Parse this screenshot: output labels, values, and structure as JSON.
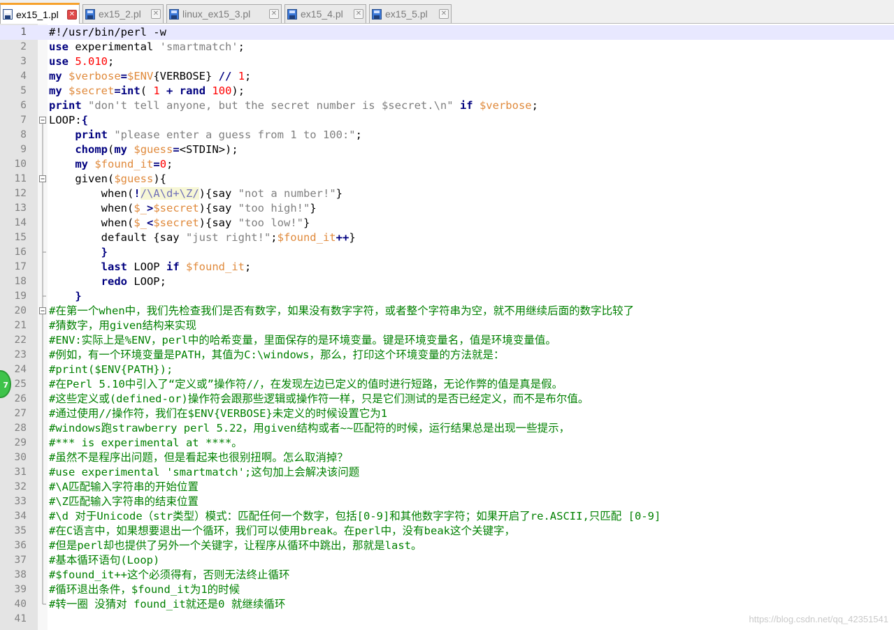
{
  "tabs": [
    {
      "label": "ex15_1.pl",
      "active": true
    },
    {
      "label": "ex15_2.pl",
      "active": false
    },
    {
      "label": "linux_ex15_3.pl",
      "active": false
    },
    {
      "label": "ex15_4.pl",
      "active": false
    },
    {
      "label": "ex15_5.pl",
      "active": false
    }
  ],
  "editor": {
    "current_line": 1,
    "lines": [
      [
        [
          "#!/usr/bin/perl -w",
          ""
        ]
      ],
      [
        [
          "use",
          "kw"
        ],
        [
          " experimental ",
          ""
        ],
        [
          "'smartmatch'",
          "str"
        ],
        [
          ";",
          ""
        ]
      ],
      [
        [
          "use",
          "kw"
        ],
        [
          " ",
          ""
        ],
        [
          "5.010",
          "num"
        ],
        [
          ";",
          ""
        ]
      ],
      [
        [
          "my",
          "kw"
        ],
        [
          " ",
          ""
        ],
        [
          "$verbose",
          "var"
        ],
        [
          "=",
          "op"
        ],
        [
          "$ENV",
          "var"
        ],
        [
          "{VERBOSE} ",
          ""
        ],
        [
          "//",
          "op"
        ],
        [
          " ",
          ""
        ],
        [
          "1",
          "num"
        ],
        [
          ";",
          ""
        ]
      ],
      [
        [
          "my",
          "kw"
        ],
        [
          " ",
          ""
        ],
        [
          "$secret",
          "var"
        ],
        [
          "=",
          "op"
        ],
        [
          "int",
          "kw"
        ],
        [
          "( ",
          ""
        ],
        [
          "1",
          "num"
        ],
        [
          " ",
          ""
        ],
        [
          "+",
          "op"
        ],
        [
          " ",
          ""
        ],
        [
          "rand",
          "kw"
        ],
        [
          " ",
          ""
        ],
        [
          "100",
          "num"
        ],
        [
          ");",
          ""
        ]
      ],
      [
        [
          "print",
          "kw"
        ],
        [
          " ",
          ""
        ],
        [
          "\"don't tell anyone, but the secret number is $secret.\\n\"",
          "str"
        ],
        [
          " ",
          ""
        ],
        [
          "if",
          "kw"
        ],
        [
          " ",
          ""
        ],
        [
          "$verbose",
          "var"
        ],
        [
          ";",
          ""
        ]
      ],
      [
        [
          "LOOP:",
          ""
        ],
        [
          "{",
          "op"
        ]
      ],
      [
        [
          "    ",
          ""
        ],
        [
          "print",
          "kw"
        ],
        [
          " ",
          ""
        ],
        [
          "\"please enter a guess from 1 to 100:\"",
          "str"
        ],
        [
          ";",
          ""
        ]
      ],
      [
        [
          "    ",
          ""
        ],
        [
          "chomp",
          "kw"
        ],
        [
          "(",
          ""
        ],
        [
          "my",
          "kw"
        ],
        [
          " ",
          ""
        ],
        [
          "$guess",
          "var"
        ],
        [
          "=",
          "op"
        ],
        [
          "<STDIN>",
          ""
        ],
        [
          ");",
          ""
        ]
      ],
      [
        [
          "    ",
          ""
        ],
        [
          "my",
          "kw"
        ],
        [
          " ",
          ""
        ],
        [
          "$found_it",
          "var"
        ],
        [
          "=",
          "op"
        ],
        [
          "0",
          "num"
        ],
        [
          ";",
          ""
        ]
      ],
      [
        [
          "    given(",
          ""
        ],
        [
          "$guess",
          "var"
        ],
        [
          "){",
          ""
        ]
      ],
      [
        [
          "        when(",
          ""
        ],
        [
          "!",
          "op"
        ],
        [
          "/\\A\\d+\\Z/",
          "rx"
        ],
        [
          "){say ",
          ""
        ],
        [
          "\"not a number!\"",
          "str"
        ],
        [
          "}",
          ""
        ]
      ],
      [
        [
          "        when(",
          ""
        ],
        [
          "$_",
          "var"
        ],
        [
          ">",
          "op"
        ],
        [
          "$secret",
          "var"
        ],
        [
          "){say ",
          ""
        ],
        [
          "\"too high!\"",
          "str"
        ],
        [
          "}",
          ""
        ]
      ],
      [
        [
          "        when(",
          ""
        ],
        [
          "$_",
          "var"
        ],
        [
          "<",
          "op"
        ],
        [
          "$secret",
          "var"
        ],
        [
          "){say ",
          ""
        ],
        [
          "\"too low!\"",
          "str"
        ],
        [
          "}",
          ""
        ]
      ],
      [
        [
          "        default {say ",
          ""
        ],
        [
          "\"just right!\"",
          "str"
        ],
        [
          ";",
          ""
        ],
        [
          "$found_it",
          "var"
        ],
        [
          "++",
          "op"
        ],
        [
          "}",
          ""
        ]
      ],
      [
        [
          "        ",
          ""
        ],
        [
          "}",
          "op"
        ]
      ],
      [
        [
          "        ",
          ""
        ],
        [
          "last",
          "kw"
        ],
        [
          " LOOP ",
          ""
        ],
        [
          "if",
          "kw"
        ],
        [
          " ",
          ""
        ],
        [
          "$found_it",
          "var"
        ],
        [
          ";",
          ""
        ]
      ],
      [
        [
          "        ",
          ""
        ],
        [
          "redo",
          "kw"
        ],
        [
          " LOOP;",
          ""
        ]
      ],
      [
        [
          "    ",
          ""
        ],
        [
          "}",
          "op"
        ]
      ],
      [
        [
          "#在第一个when中，我们先检查我们是否有数字，如果没有数字字符，或者整个字符串为空，就不用继续后面的数字比较了",
          "cm"
        ]
      ],
      [
        [
          "#猜数字，用given结构来实现",
          "cm"
        ]
      ],
      [
        [
          "#ENV:实际上是%ENV，perl中的哈希变量，里面保存的是环境变量。键是环境变量名，值是环境变量值。",
          "cm"
        ]
      ],
      [
        [
          "#例如，有一个环境变量是PATH，其值为C:\\windows，那么，打印这个环境变量的方法就是：",
          "cm"
        ]
      ],
      [
        [
          "#print($ENV{PATH});",
          "cm"
        ]
      ],
      [
        [
          "#在Perl 5.10中引入了“定义或”操作符//，在发现左边已定义的值时进行短路，无论作弊的值是真是假。",
          "cm"
        ]
      ],
      [
        [
          "#这些定义或(defined-or)操作符会跟那些逻辑或操作符一样，只是它们测试的是否已经定义，而不是布尔值。",
          "cm"
        ]
      ],
      [
        [
          "#通过使用//操作符，我们在$ENV{VERBOSE}未定义的时候设置它为1",
          "cm"
        ]
      ],
      [
        [
          "#windows跑strawberry perl 5.22，用given结构或者~~匹配符的时候，运行结果总是出现一些提示，",
          "cm"
        ]
      ],
      [
        [
          "#*** is experimental at ****。",
          "cm"
        ]
      ],
      [
        [
          "#虽然不是程序出问题，但是看起来也很别扭啊。怎么取消掉？",
          "cm"
        ]
      ],
      [
        [
          "#use experimental 'smartmatch';这句加上会解决该问题",
          "cm"
        ]
      ],
      [
        [
          "#\\A匹配输入字符串的开始位置",
          "cm"
        ]
      ],
      [
        [
          "#\\Z匹配输入字符串的结束位置",
          "cm"
        ]
      ],
      [
        [
          "#\\d 对于Unicode（str类型）模式：匹配任何一个数字，包括[0-9]和其他数字字符；如果开启了re.ASCII,只匹配 [0-9]",
          "cm"
        ]
      ],
      [
        [
          "#在C语言中，如果想要退出一个循环，我们可以使用break。在perl中，没有beak这个关键字，",
          "cm"
        ]
      ],
      [
        [
          "#但是perl却也提供了另外一个关键字，让程序从循环中跳出，那就是last。",
          "cm"
        ]
      ],
      [
        [
          "#基本循环语句(Loop)",
          "cm"
        ]
      ],
      [
        [
          "#$found_it++这个必须得有，否则无法终止循环",
          "cm"
        ]
      ],
      [
        [
          "#循环退出条件，$found_it为1的时候",
          "cm"
        ]
      ],
      [
        [
          "#转一圈 没猜对 found_it就还是0 就继续循环",
          "cm"
        ]
      ],
      [
        [
          "",
          ""
        ]
      ]
    ],
    "folds": {
      "7": "open",
      "11": "open",
      "16": "mid",
      "19": "end",
      "20": "open",
      "40": "end"
    },
    "fold_range": [
      7,
      40
    ]
  },
  "badge_text": "7",
  "watermark": "https://blog.csdn.net/qq_42351541",
  "colors": {
    "keyword": "#00007f",
    "string": "#7f7f7f",
    "variable": "#e08a3c",
    "number": "#ff0000",
    "comment": "#008000",
    "tab_accent": "#f6a12b"
  }
}
